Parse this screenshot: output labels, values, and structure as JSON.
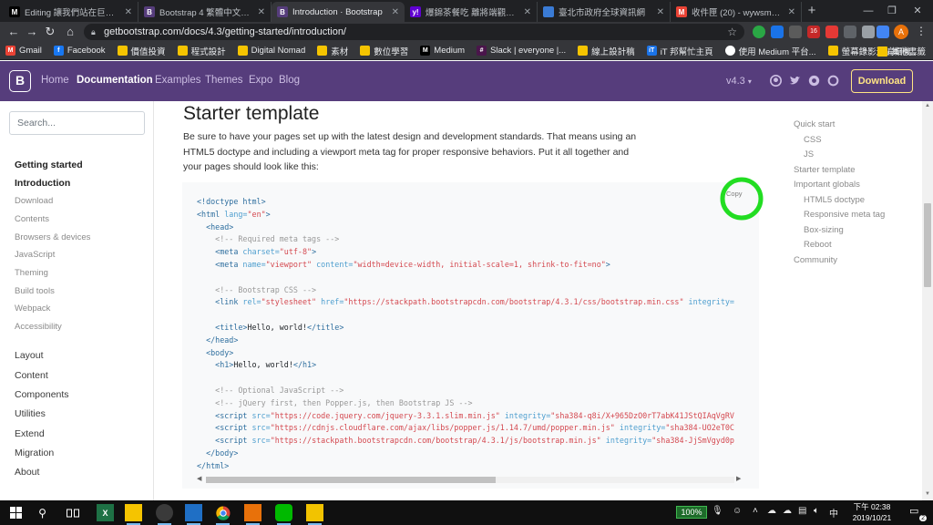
{
  "browser": {
    "tabs": [
      {
        "title": "Editing 讓我們站在巨人的肩",
        "favicon_text": "M",
        "favicon_color": "#000000",
        "active": false
      },
      {
        "title": "Bootstrap 4 繁體中文手冊 |",
        "favicon_text": "B",
        "favicon_color": "#563d7c",
        "active": false
      },
      {
        "title": "Introduction · Bootstrap",
        "favicon_text": "B",
        "favicon_color": "#563d7c",
        "active": true
      },
      {
        "title": "爆錦茶餐吃 離將端觀象…",
        "favicon_text": "y!",
        "favicon_color": "#5f01d1",
        "active": false
      },
      {
        "title": "臺北市政府全球資訊網",
        "favicon_text": "",
        "favicon_color": "#3a7bd5",
        "active": false
      },
      {
        "title": "收件匣 (20) - wywsmail@gm",
        "favicon_text": "M",
        "favicon_color": "#ea4335",
        "active": false
      }
    ],
    "url": "getbootstrap.com/docs/4.3/getting-started/introduction/",
    "bookmarks": [
      {
        "label": "Gmail",
        "icon": "gmail-icon",
        "color": "#ea4335",
        "text": "M"
      },
      {
        "label": "Facebook",
        "icon": "facebook-icon",
        "color": "#1877f2",
        "text": "f"
      },
      {
        "label": "價值投資",
        "icon": "folder-icon",
        "color": "",
        "text": ""
      },
      {
        "label": "程式設計",
        "icon": "folder-icon",
        "color": "",
        "text": ""
      },
      {
        "label": "Digital Nomad",
        "icon": "folder-icon",
        "color": "",
        "text": ""
      },
      {
        "label": "素材",
        "icon": "folder-icon",
        "color": "",
        "text": ""
      },
      {
        "label": "數位學習",
        "icon": "folder-icon",
        "color": "",
        "text": ""
      },
      {
        "label": "Medium",
        "icon": "medium-icon",
        "color": "#000000",
        "text": "M"
      },
      {
        "label": "Slack | everyone |...",
        "icon": "slack-icon",
        "color": "#4a154b",
        "text": "#"
      },
      {
        "label": "線上設計稿",
        "icon": "folder-icon",
        "color": "",
        "text": ""
      },
      {
        "label": "iT 邦幫忙主頁",
        "icon": "ithelp-icon",
        "color": "#1a73e8",
        "text": "iT"
      },
      {
        "label": "使用 Medium 平台...",
        "icon": "globe-icon",
        "color": "#ffffff",
        "text": ""
      },
      {
        "label": "螢幕錄影還編輯機...",
        "icon": "folder-icon",
        "color": "",
        "text": ""
      }
    ],
    "bookmarks_more": "»",
    "other_bookmarks": "其他書籤",
    "avatar_letter": "A",
    "ext_badge": "16"
  },
  "navbar": {
    "logo": "B",
    "links": [
      "Home",
      "Documentation",
      "Examples",
      "Themes",
      "Expo",
      "Blog"
    ],
    "active_link": "Documentation",
    "version": "v4.3",
    "download_label": "Download"
  },
  "sidebar": {
    "search_placeholder": "Search...",
    "active_section": "Getting started",
    "getting_started_items": [
      "Introduction",
      "Download",
      "Contents",
      "Browsers & devices",
      "JavaScript",
      "Theming",
      "Build tools",
      "Webpack",
      "Accessibility"
    ],
    "active_item": "Introduction",
    "sections": [
      "Layout",
      "Content",
      "Components",
      "Utilities",
      "Extend",
      "Migration",
      "About"
    ]
  },
  "main": {
    "title": "Starter template",
    "lead": "Be sure to have your pages set up with the latest design and development standards. That means using an HTML5 doctype and including a viewport meta tag for proper responsive behaviors. Put it all together and your pages should look like this:",
    "copy_label": "Copy",
    "code_lines": [
      [
        [
          "tg",
          "<!doctype html>"
        ]
      ],
      [
        [
          "tg",
          "<html "
        ],
        [
          "at",
          "lang="
        ],
        [
          "st",
          "\"en\""
        ],
        [
          "tg",
          ">"
        ]
      ],
      [
        [
          "tg",
          "  <head>"
        ]
      ],
      [
        [
          "cm",
          "    <!-- Required meta tags -->"
        ]
      ],
      [
        [
          "tg",
          "    <meta "
        ],
        [
          "at",
          "charset="
        ],
        [
          "st",
          "\"utf-8\""
        ],
        [
          "tg",
          ">"
        ]
      ],
      [
        [
          "tg",
          "    <meta "
        ],
        [
          "at",
          "name="
        ],
        [
          "st",
          "\"viewport\" "
        ],
        [
          "at",
          "content="
        ],
        [
          "st",
          "\"width=device-width, initial-scale=1, shrink-to-fit=no\""
        ],
        [
          "tg",
          ">"
        ]
      ],
      [
        [
          "tg",
          ""
        ]
      ],
      [
        [
          "cm",
          "    <!-- Bootstrap CSS -->"
        ]
      ],
      [
        [
          "tg",
          "    <link "
        ],
        [
          "at",
          "rel="
        ],
        [
          "st",
          "\"stylesheet\" "
        ],
        [
          "at",
          "href="
        ],
        [
          "st",
          "\"https://stackpath.bootstrapcdn.com/bootstrap/4.3.1/css/bootstrap.min.css\" "
        ],
        [
          "at",
          "integrity="
        ]
      ],
      [
        [
          "tg",
          ""
        ]
      ],
      [
        [
          "tg",
          "    <title>"
        ],
        [
          "",
          ""
        ],
        [
          "",
          "Hello, world!"
        ],
        [
          "tg",
          "</title>"
        ]
      ],
      [
        [
          "tg",
          "  </head>"
        ]
      ],
      [
        [
          "tg",
          "  <body>"
        ]
      ],
      [
        [
          "tg",
          "    <h1>"
        ],
        [
          "",
          "Hello, world!"
        ],
        [
          "tg",
          "</h1>"
        ]
      ],
      [
        [
          "tg",
          ""
        ]
      ],
      [
        [
          "cm",
          "    <!-- Optional JavaScript -->"
        ]
      ],
      [
        [
          "cm",
          "    <!-- jQuery first, then Popper.js, then Bootstrap JS -->"
        ]
      ],
      [
        [
          "tg",
          "    <script "
        ],
        [
          "at",
          "src="
        ],
        [
          "st",
          "\"https://code.jquery.com/jquery-3.3.1.slim.min.js\" "
        ],
        [
          "at",
          "integrity="
        ],
        [
          "st",
          "\"sha384-q8i/X+965DzO0rT7abK41JStQIAqVgRV"
        ]
      ],
      [
        [
          "tg",
          "    <script "
        ],
        [
          "at",
          "src="
        ],
        [
          "st",
          "\"https://cdnjs.cloudflare.com/ajax/libs/popper.js/1.14.7/umd/popper.min.js\" "
        ],
        [
          "at",
          "integrity="
        ],
        [
          "st",
          "\"sha384-UO2eT0C"
        ]
      ],
      [
        [
          "tg",
          "    <script "
        ],
        [
          "at",
          "src="
        ],
        [
          "st",
          "\"https://stackpath.bootstrapcdn.com/bootstrap/4.3.1/js/bootstrap.min.js\" "
        ],
        [
          "at",
          "integrity="
        ],
        [
          "st",
          "\"sha384-JjSmVgyd0p"
        ]
      ],
      [
        [
          "tg",
          "  </body>"
        ]
      ],
      [
        [
          "tg",
          "</html>"
        ]
      ]
    ]
  },
  "toc": {
    "items": [
      {
        "label": "Quick start",
        "level": 1
      },
      {
        "label": "CSS",
        "level": 2
      },
      {
        "label": "JS",
        "level": 2
      },
      {
        "label": "Starter template",
        "level": 1
      },
      {
        "label": "Important globals",
        "level": 1
      },
      {
        "label": "HTML5 doctype",
        "level": 2
      },
      {
        "label": "Responsive meta tag",
        "level": 2
      },
      {
        "label": "Box-sizing",
        "level": 2
      },
      {
        "label": "Reboot",
        "level": 2
      },
      {
        "label": "Community",
        "level": 1
      }
    ]
  },
  "taskbar": {
    "battery": "100%",
    "ime": "中",
    "time": "下午 02:38",
    "date": "2019/10/21",
    "notification_count": "2"
  },
  "colors": {
    "navbar": "#563d7c",
    "download": "#ffe484",
    "annotation_circle": "#22dd22"
  }
}
